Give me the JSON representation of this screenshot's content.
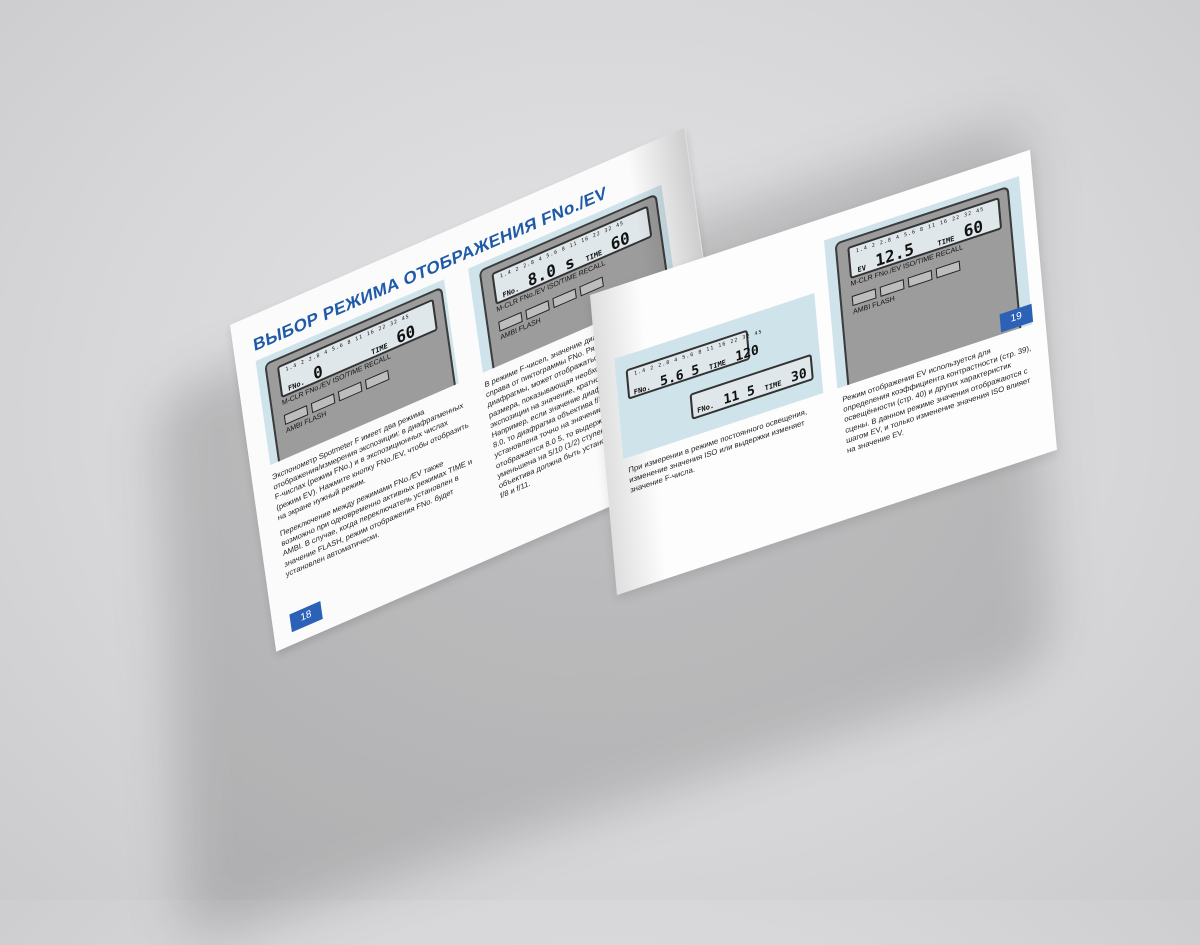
{
  "left_page": {
    "title": "ВЫБОР РЕЖИМА ОТОБРАЖЕНИЯ FNo./EV",
    "page_number": "18",
    "meter_a": {
      "scale": "1.4 2 2.8 4 5.6 8 11 16 22 32 45",
      "fno_label": "FNo.",
      "fno_value": "0",
      "time_label": "TIME",
      "time_value": "60",
      "buttons": "M-CLR   FNo./EV   ISO/TIME   RECALL",
      "switch": "AMBI   FLASH"
    },
    "meter_b": {
      "scale": "1.4 2 2.8 4 5.6 8 11 16 22 32 45",
      "fno_label": "FNo.",
      "fno_value": "8.0 s",
      "time_label": "TIME",
      "time_value": "60",
      "buttons": "M-CLR   FNo./EV   ISO/TIME   RECALL",
      "switch": "AMBI   FLASH"
    },
    "col1_p1": "Экспонометр Spotmeter F имеет два режима отображения/измерения экспозиции: в диафрагменных F-числах (режим FNo.) и в экспозиционных числах (режим EV). Нажмите кнопку FNo./EV, чтобы отобразить на экране нужный режим.",
    "col1_p2": "Переключение между режимами FNo./EV также возможно при одновременно активных режимах TIME и AMBI. В случае, когда переключатель установлен в значение FLASH, режим отображения FNo. будет установлен автоматически.",
    "col2_p1": "В режиме F-чисел, значение диафрагмы отображается справа от пиктограммы FNo. Рядом со значением диафрагмы, может отображаться цифра меньшего размера, показывающая необходимую поправку экспозиции на значение, кратное 1/10 ступени. Например, если значение диафрагмы на экране равно 8.0, то диафрагма объектива f/8 должна быть установлена точно на значение f/8. Если на экране отображается 8.0 5, то выдержка должна быть уменьшена на 5/10 (1/2) ступени. Или диафрагма объектива должна быть установлена на значение между f/8 и f/11."
  },
  "right_page": {
    "page_number": "19",
    "meter_c": {
      "scale": "1.4 2 2.8 4 5.6 8 11 16 22 32 45",
      "fno_label": "FNo.",
      "fno_value": "5.6 5",
      "time_label": "TIME",
      "time_value": "120"
    },
    "meter_d": {
      "fno_label": "FNo.",
      "fno_value": "11 5",
      "time_label": "TIME",
      "time_value": "30"
    },
    "meter_e": {
      "scale": "1.4 2 2.8 4 5.6 8 11 16 22 32 45",
      "ev_label": "EV",
      "ev_value": "12.5",
      "time_label": "TIME",
      "time_value": "60",
      "buttons": "M-CLR   FNo./EV   ISO/TIME   RECALL",
      "switch": "AMBI   FLASH"
    },
    "caption_c": "При измерении в режиме постоянного освещения, изменение значения ISO или выдержки изменяет значение F-числа.",
    "caption_e": "Режим отображения EV используется для определения коэффициента контрастности (стр. 39), освещённости (стр. 40) и других характеристик сцены. В данном режиме значения отображаются с шагом EV, и только изменение значения ISO влияет на значение EV."
  },
  "colors": {
    "accent": "#2b62b8",
    "photo_bg": "#cfe3ea",
    "page": "#fbfbfb"
  }
}
